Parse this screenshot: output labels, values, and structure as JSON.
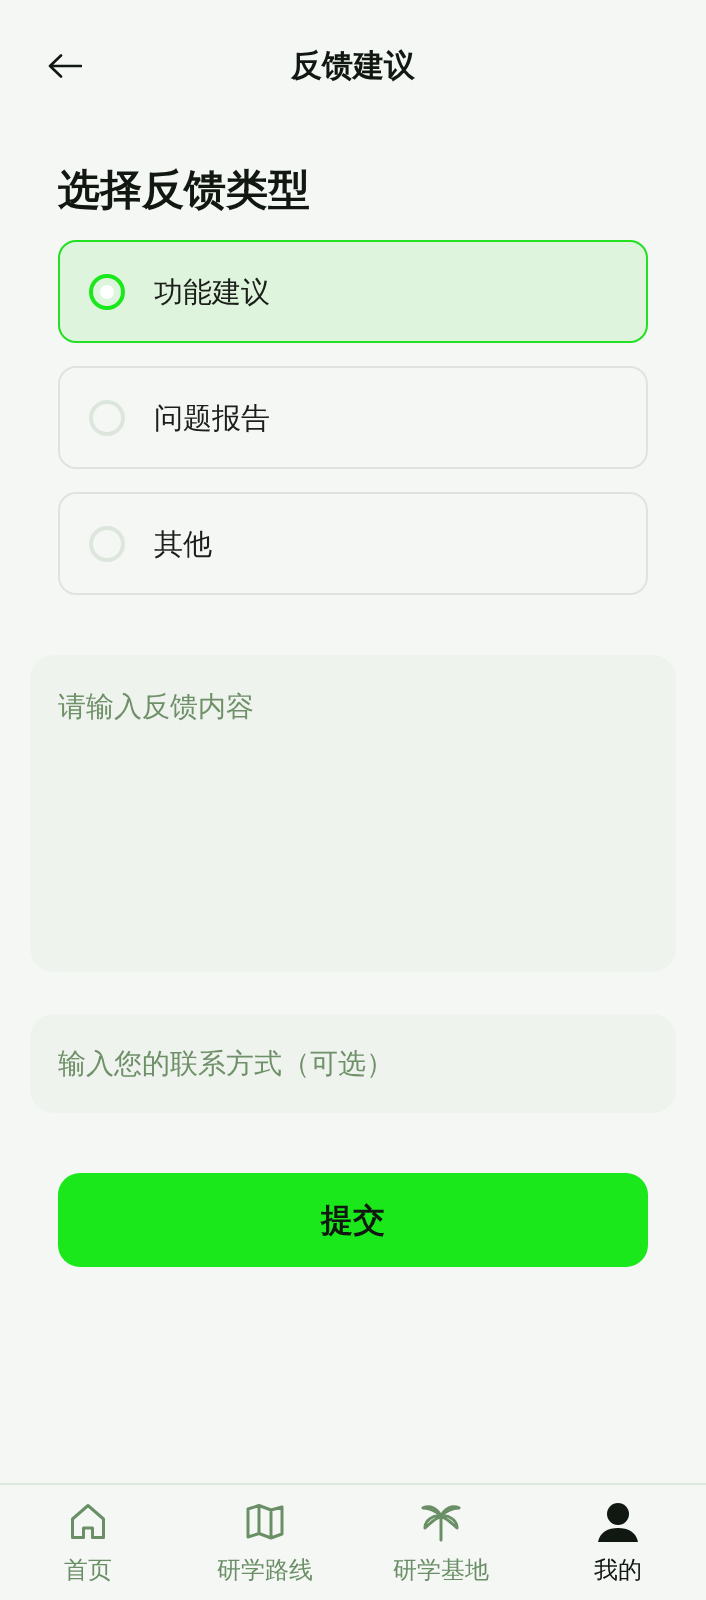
{
  "header": {
    "title": "反馈建议"
  },
  "section_title": "选择反馈类型",
  "feedback_types": [
    {
      "label": "功能建议",
      "selected": true
    },
    {
      "label": "问题报告",
      "selected": false
    },
    {
      "label": "其他",
      "selected": false
    }
  ],
  "content_field": {
    "placeholder": "请输入反馈内容"
  },
  "contact_field": {
    "placeholder": "输入您的联系方式（可选）"
  },
  "submit_button": {
    "label": "提交"
  },
  "bottom_nav": [
    {
      "label": "首页",
      "kind": "home",
      "selected": false
    },
    {
      "label": "研学路线",
      "kind": "map",
      "selected": false
    },
    {
      "label": "研学基地",
      "kind": "palm",
      "selected": false
    },
    {
      "label": "我的",
      "kind": "person",
      "selected": true
    }
  ]
}
